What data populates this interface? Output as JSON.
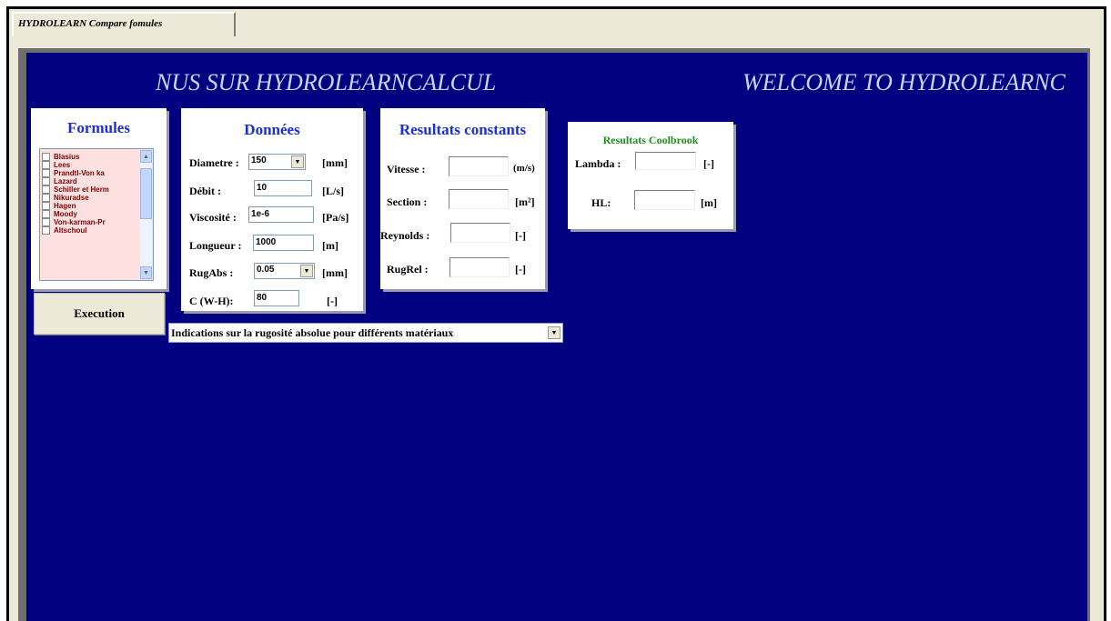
{
  "window": {
    "tab_label": "HYDROLEARN Compare fomules"
  },
  "banner": {
    "left_text": "NUS SUR HYDROLEARNCALCUL",
    "right_text": "WELCOME TO HYDROLEARNC"
  },
  "formules": {
    "title": "Formules",
    "items": [
      "Blasius",
      "Lees",
      "Prandtl-Von ka",
      "Lazard",
      "Schiller et Herm",
      "Nikuradse",
      "Hagen",
      "Moody",
      "Von-karman-Pr",
      "Altschoul"
    ]
  },
  "donnees": {
    "title": "Données",
    "diametre": {
      "label": "Diametre :",
      "value": "150",
      "unit": "[mm]"
    },
    "debit": {
      "label": "Débit :",
      "value": "10",
      "unit": "[L/s]"
    },
    "viscosite": {
      "label": "Viscosité :",
      "value": "1e-6",
      "unit": "[Pa/s]"
    },
    "longueur": {
      "label": "Longueur :",
      "value": "1000",
      "unit": "[m]"
    },
    "rugabs": {
      "label": "RugAbs :",
      "value": "0.05",
      "unit": "[mm]"
    },
    "c_wh": {
      "label": "C (W-H):",
      "value": "80",
      "unit": "[-]"
    }
  },
  "resultats_constants": {
    "title": "Resultats constants",
    "vitesse": {
      "label": "Vitesse :",
      "value": "",
      "unit": "(m/s)"
    },
    "section": {
      "label": "Section :",
      "value": "",
      "unit": "[m²]"
    },
    "reynolds": {
      "label": "Reynolds :",
      "value": "",
      "unit": "[-]"
    },
    "rugrel": {
      "label": "RugRel :",
      "value": "",
      "unit": "[-]"
    }
  },
  "resultats_coolbrook": {
    "title": "Resultats Coolbrook",
    "lambda": {
      "label": "Lambda :",
      "value": "",
      "unit": "[-]"
    },
    "hl": {
      "label": "HL:",
      "value": "",
      "unit": "[m]"
    }
  },
  "execution_button": "Execution",
  "indications_select": "Indications sur la rugosité absolue pour différents matériaux",
  "icons": {
    "dropdown": "chevron-down-icon",
    "scroll_up": "chevron-up-icon",
    "checkbox": "checkbox-icon"
  },
  "colors": {
    "background_blue": "#000080",
    "title_blue": "#1c2fd6",
    "coolbrook_green": "#1e8f1e",
    "list_bg": "#fde1e1",
    "list_text": "#800000"
  }
}
